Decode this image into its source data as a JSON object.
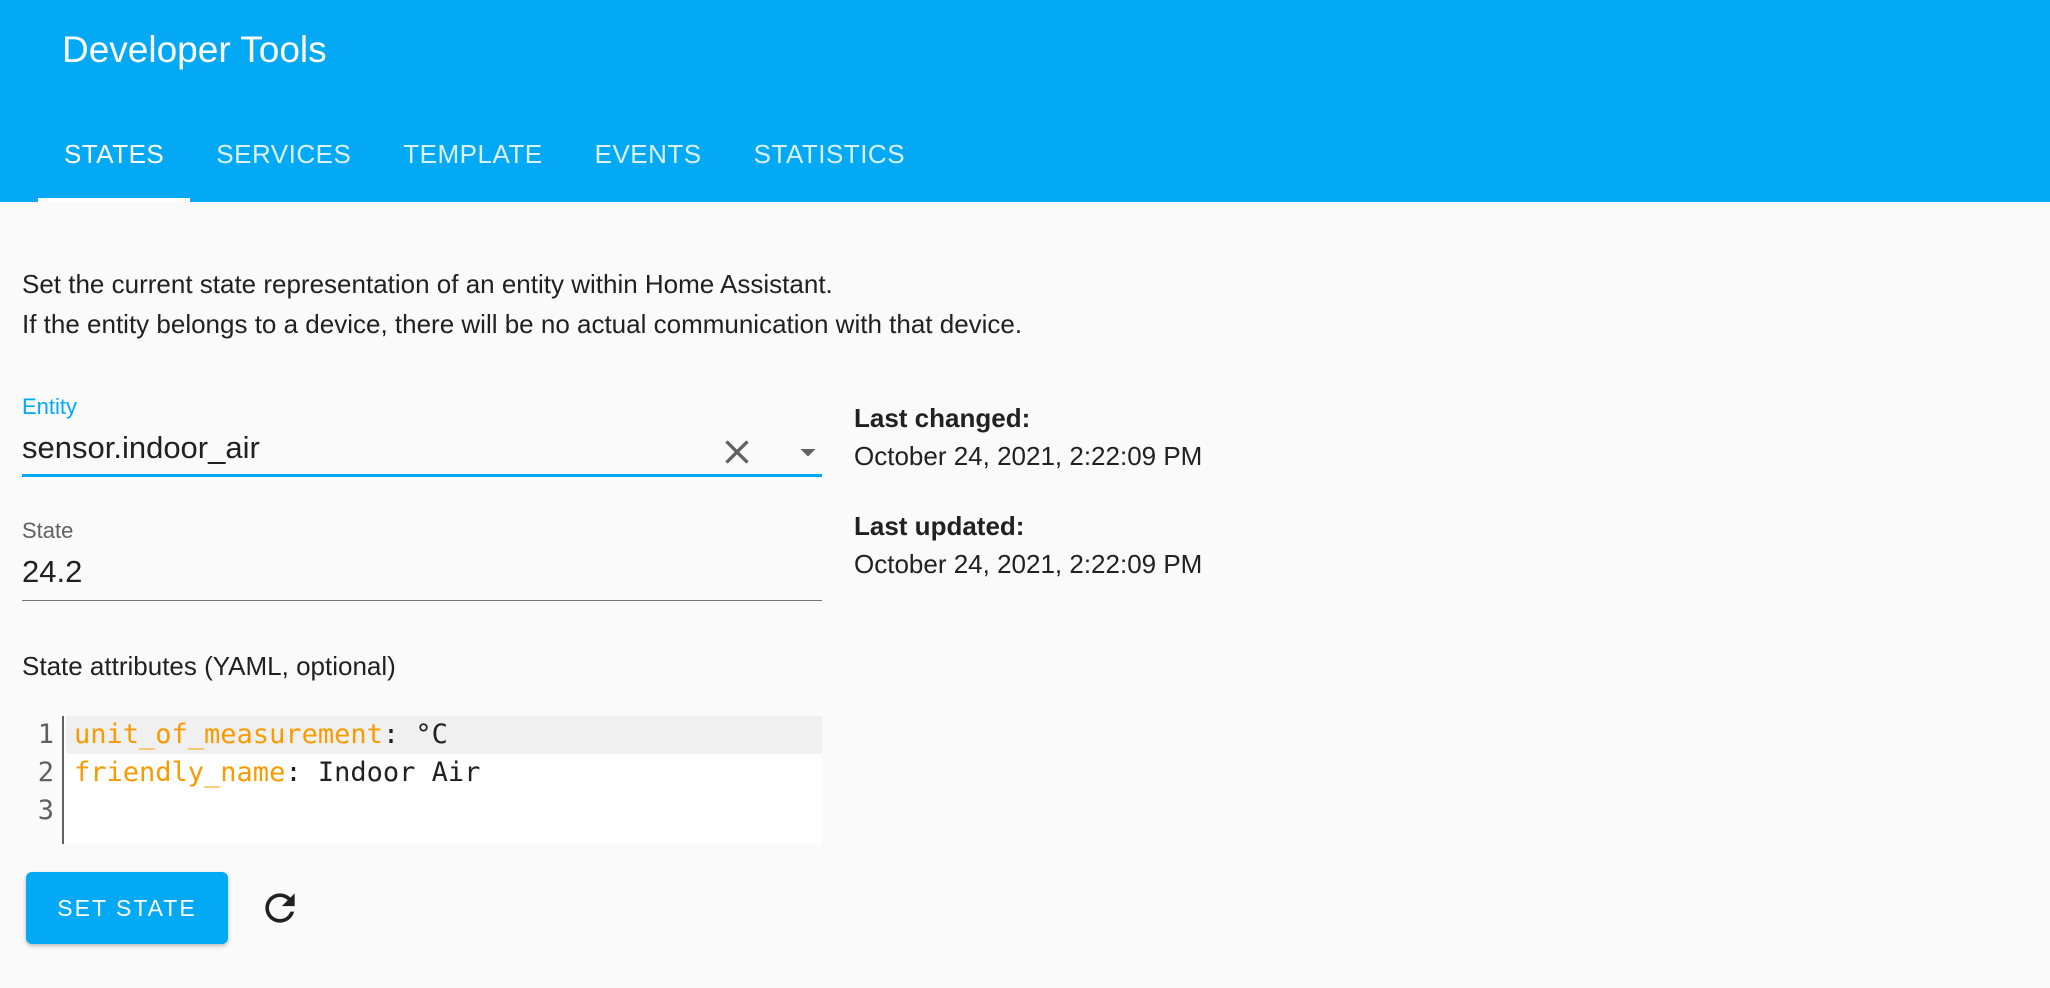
{
  "header": {
    "title": "Developer Tools",
    "tabs": [
      {
        "label": "STATES",
        "active": true
      },
      {
        "label": "SERVICES",
        "active": false
      },
      {
        "label": "TEMPLATE",
        "active": false
      },
      {
        "label": "EVENTS",
        "active": false
      },
      {
        "label": "STATISTICS",
        "active": false
      }
    ]
  },
  "description": {
    "line1": "Set the current state representation of an entity within Home Assistant.",
    "line2": "If the entity belongs to a device, there will be no actual communication with that device."
  },
  "entity_field": {
    "label": "Entity",
    "value": "sensor.indoor_air",
    "clear_icon": "close-icon",
    "dropdown_icon": "menu-down-icon"
  },
  "state_field": {
    "label": "State",
    "value": "24.2"
  },
  "attributes": {
    "label": "State attributes (YAML, optional)",
    "lines": [
      {
        "num": "1",
        "key": "unit_of_measurement",
        "sep": ": ",
        "value": "°C"
      },
      {
        "num": "2",
        "key": "friendly_name",
        "sep": ": ",
        "value": "Indoor Air"
      },
      {
        "num": "3",
        "key": "",
        "sep": "",
        "value": ""
      }
    ]
  },
  "actions": {
    "set_state_label": "SET STATE",
    "refresh_icon": "refresh-icon"
  },
  "meta": {
    "last_changed_label": "Last changed:",
    "last_changed_value": "October 24, 2021, 2:22:09 PM",
    "last_updated_label": "Last updated:",
    "last_updated_value": "October 24, 2021, 2:22:09 PM"
  },
  "colors": {
    "primary": "#03a9f4",
    "yaml_key": "#f79b00",
    "background": "#fafafa"
  }
}
